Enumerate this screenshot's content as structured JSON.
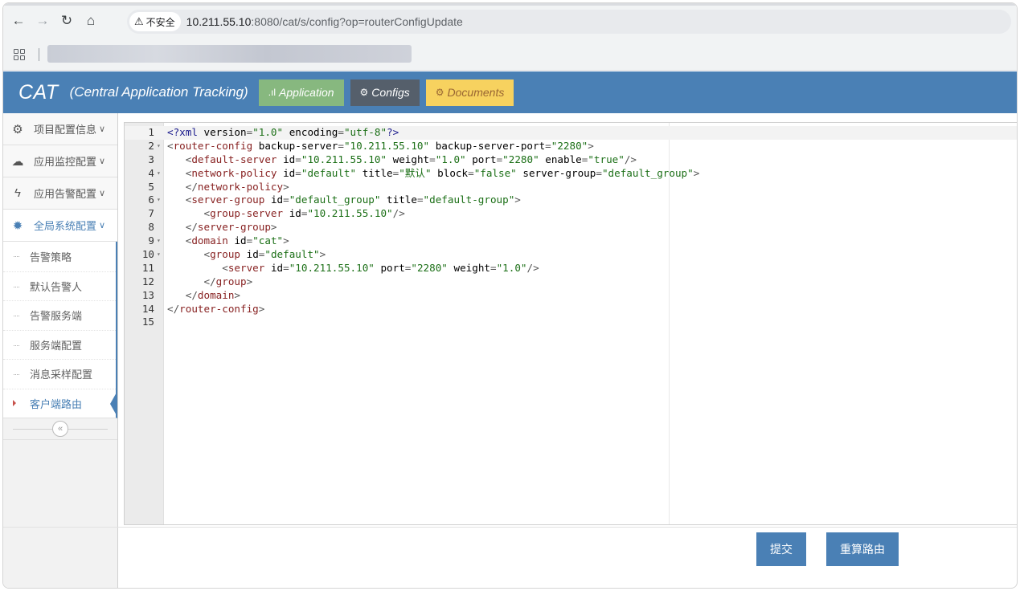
{
  "browser": {
    "security_label": "不安全",
    "url_host": "10.211.55.10",
    "url_rest": ":8080/cat/s/config?op=routerConfigUpdate"
  },
  "header": {
    "brand": "CAT",
    "subtitle": "(Central Application Tracking)",
    "nav": [
      {
        "label": "Application",
        "icon": "signal-bars-icon",
        "color": "#87b87f"
      },
      {
        "label": "Configs",
        "icon": "cogs-icon",
        "color": "#555f6b"
      },
      {
        "label": "Documents",
        "icon": "cogs-icon",
        "color": "#f7d25f"
      }
    ]
  },
  "sidebar": {
    "menus": [
      {
        "label": "项目配置信息",
        "icon": "cogs-icon"
      },
      {
        "label": "应用监控配置",
        "icon": "cloud-icon"
      },
      {
        "label": "应用告警配置",
        "icon": "bolt-icon"
      },
      {
        "label": "全局系统配置",
        "icon": "gear-icon",
        "active": true
      }
    ],
    "submenu": [
      {
        "label": "告警策略"
      },
      {
        "label": "默认告警人"
      },
      {
        "label": "告警服务端"
      },
      {
        "label": "服务端配置"
      },
      {
        "label": "消息采样配置"
      },
      {
        "label": "客户端路由",
        "current": true
      }
    ],
    "collapse_glyph": "«"
  },
  "editor": {
    "lines": [
      {
        "n": "1",
        "fold": "",
        "text": "<?xml version=\"1.0\" encoding=\"utf-8\"?>"
      },
      {
        "n": "2",
        "fold": "▾",
        "text": "<router-config backup-server=\"10.211.55.10\" backup-server-port=\"2280\">"
      },
      {
        "n": "3",
        "fold": "",
        "text": "   <default-server id=\"10.211.55.10\" weight=\"1.0\" port=\"2280\" enable=\"true\"/>"
      },
      {
        "n": "4",
        "fold": "▾",
        "text": "   <network-policy id=\"default\" title=\"默认\" block=\"false\" server-group=\"default_group\">"
      },
      {
        "n": "5",
        "fold": "",
        "text": "   </network-policy>"
      },
      {
        "n": "6",
        "fold": "▾",
        "text": "   <server-group id=\"default_group\" title=\"default-group\">"
      },
      {
        "n": "7",
        "fold": "",
        "text": "      <group-server id=\"10.211.55.10\"/>"
      },
      {
        "n": "8",
        "fold": "",
        "text": "   </server-group>"
      },
      {
        "n": "9",
        "fold": "▾",
        "text": "   <domain id=\"cat\">"
      },
      {
        "n": "10",
        "fold": "▾",
        "text": "      <group id=\"default\">"
      },
      {
        "n": "11",
        "fold": "",
        "text": "         <server id=\"10.211.55.10\" port=\"2280\" weight=\"1.0\"/>"
      },
      {
        "n": "12",
        "fold": "",
        "text": "      </group>"
      },
      {
        "n": "13",
        "fold": "",
        "text": "   </domain>"
      },
      {
        "n": "14",
        "fold": "",
        "text": "</router-config>"
      },
      {
        "n": "15",
        "fold": "",
        "text": ""
      }
    ]
  },
  "actions": {
    "submit_label": "提交",
    "reroute_label": "重算路由"
  }
}
